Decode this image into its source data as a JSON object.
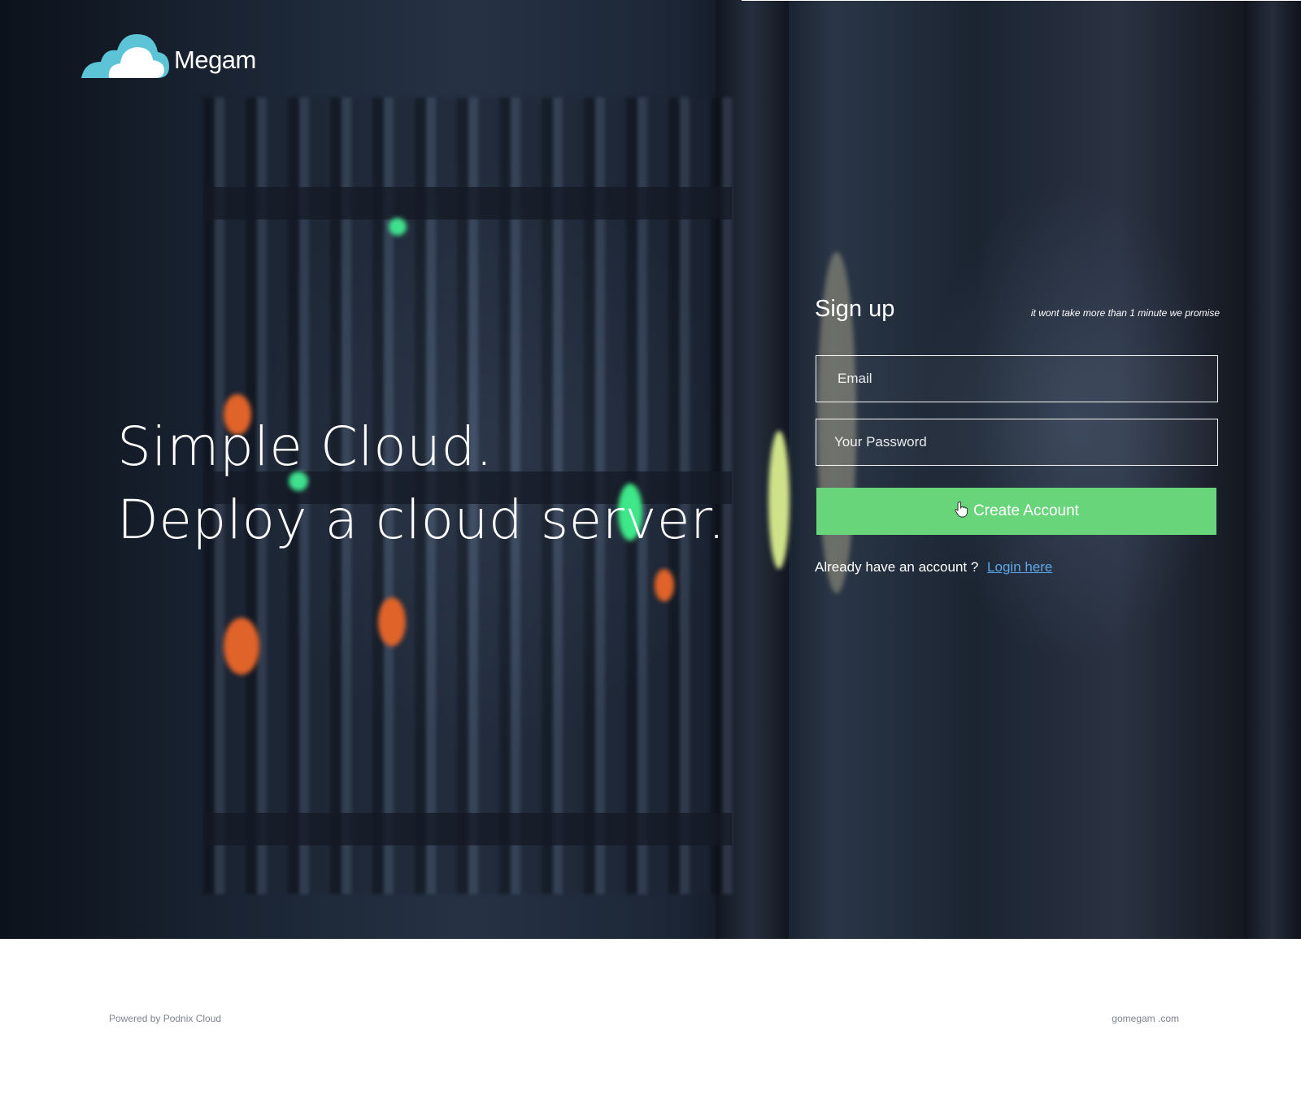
{
  "brand": {
    "name": "Megam",
    "logo_icon": "cloud-icon",
    "colors": {
      "cloud_light": "#ffffff",
      "cloud_accent": "#5cc4d6"
    }
  },
  "hero": {
    "line1": "Simple Cloud.",
    "line2": "Deploy a cloud server."
  },
  "signup": {
    "title": "Sign up",
    "note": "it wont take more than 1 minute we promise",
    "email_placeholder": "Email",
    "password_placeholder": "Your Password",
    "button_label": "Create Account",
    "button_color": "#68d57a",
    "already_text": "Already have an account ?",
    "login_link": "Login here",
    "link_color": "#5da8e6"
  },
  "footer": {
    "powered_by": "Powered by Podnix Cloud",
    "site": "gomegam .com"
  }
}
